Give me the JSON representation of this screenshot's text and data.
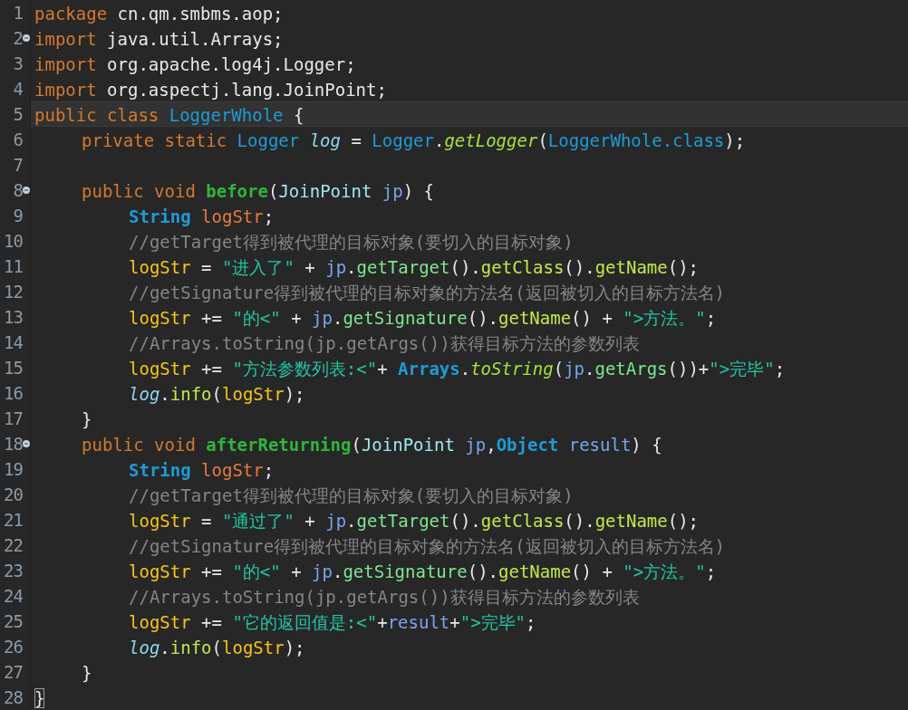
{
  "editor": {
    "lines": [
      {
        "number": "1",
        "fold": false,
        "current": false,
        "tokens": [
          {
            "kind": "kw",
            "t": "package"
          },
          {
            "kind": "plain",
            "t": " cn.qm.smbms.aop;"
          }
        ]
      },
      {
        "number": "2",
        "fold": true,
        "current": false,
        "tokens": [
          {
            "kind": "kw",
            "t": "import"
          },
          {
            "kind": "plain",
            "t": " java.util.Arrays;"
          }
        ]
      },
      {
        "number": "3",
        "fold": false,
        "current": false,
        "tokens": [
          {
            "kind": "kw",
            "t": "import"
          },
          {
            "kind": "plain",
            "t": " org.apache.log4j.Logger;"
          }
        ]
      },
      {
        "number": "4",
        "fold": false,
        "current": false,
        "tokens": [
          {
            "kind": "kw",
            "t": "import"
          },
          {
            "kind": "plain",
            "t": " org.aspectj.lang.JoinPoint;"
          }
        ]
      },
      {
        "number": "5",
        "fold": false,
        "current": true,
        "tokens": [
          {
            "kind": "kw",
            "t": "public class"
          },
          {
            "kind": "type",
            "t": " LoggerWhole"
          },
          {
            "kind": "plain",
            "t": " {"
          }
        ]
      },
      {
        "number": "6",
        "fold": false,
        "current": false,
        "tokens": [
          {
            "kind": "kw",
            "t": "\tprivate static"
          },
          {
            "kind": "type",
            "t": " Logger"
          },
          {
            "kind": "static",
            "t": " log"
          },
          {
            "kind": "plain",
            "t": " ="
          },
          {
            "kind": "type",
            "t": " Logger"
          },
          {
            "kind": "plain",
            "t": "."
          },
          {
            "kind": "smethod",
            "t": "getLogger"
          },
          {
            "kind": "plain",
            "t": "("
          },
          {
            "kind": "type",
            "t": "LoggerWhole.class"
          },
          {
            "kind": "plain",
            "t": ");"
          }
        ]
      },
      {
        "number": "7",
        "fold": false,
        "current": false
      },
      {
        "number": "8",
        "fold": true,
        "current": false,
        "tokens": [
          {
            "kind": "kw",
            "t": "\tpublic void"
          },
          {
            "kind": "decl",
            "t": " before"
          },
          {
            "kind": "plain",
            "t": "("
          },
          {
            "kind": "ptype",
            "t": "JoinPoint"
          },
          {
            "kind": "param",
            "t": " jp"
          },
          {
            "kind": "plain",
            "t": ") {"
          }
        ]
      },
      {
        "number": "9",
        "fold": false,
        "current": false,
        "tokens": [
          {
            "kind": "btype",
            "t": "\t\tString"
          },
          {
            "kind": "field",
            "t": " logStr"
          },
          {
            "kind": "plain",
            "t": ";"
          }
        ]
      },
      {
        "number": "10",
        "fold": false,
        "current": false,
        "tokens": [
          {
            "kind": "comment",
            "t": "\t\t//getTarget得到被代理的目标对象(要切入的目标对象)"
          }
        ]
      },
      {
        "number": "11",
        "fold": false,
        "current": false,
        "tokens": [
          {
            "kind": "var",
            "t": "\t\tlogStr"
          },
          {
            "kind": "plain",
            "t": " ="
          },
          {
            "kind": "str",
            "t": " \"进入了\""
          },
          {
            "kind": "plain",
            "t": " +"
          },
          {
            "kind": "param",
            "t": " jp"
          },
          {
            "kind": "plain",
            "t": "."
          },
          {
            "kind": "method",
            "t": "getTarget"
          },
          {
            "kind": "plain",
            "t": "()."
          },
          {
            "kind": "method2",
            "t": "getClass"
          },
          {
            "kind": "plain",
            "t": "()."
          },
          {
            "kind": "method2",
            "t": "getName"
          },
          {
            "kind": "plain",
            "t": "();"
          }
        ]
      },
      {
        "number": "12",
        "fold": false,
        "current": false,
        "tokens": [
          {
            "kind": "comment",
            "t": "\t\t//getSignature得到被代理的目标对象的方法名(返回被切入的目标方法名)"
          }
        ]
      },
      {
        "number": "13",
        "fold": false,
        "current": false,
        "tokens": [
          {
            "kind": "var",
            "t": "\t\tlogStr"
          },
          {
            "kind": "plain",
            "t": " +="
          },
          {
            "kind": "str",
            "t": " \"的<\""
          },
          {
            "kind": "plain",
            "t": " +"
          },
          {
            "kind": "param",
            "t": " jp"
          },
          {
            "kind": "plain",
            "t": "."
          },
          {
            "kind": "method",
            "t": "getSignature"
          },
          {
            "kind": "plain",
            "t": "()."
          },
          {
            "kind": "method2",
            "t": "getName"
          },
          {
            "kind": "plain",
            "t": "() +"
          },
          {
            "kind": "str",
            "t": " \">方法。\""
          },
          {
            "kind": "plain",
            "t": ";"
          }
        ]
      },
      {
        "number": "14",
        "fold": false,
        "current": false,
        "tokens": [
          {
            "kind": "comment",
            "t": "\t\t//Arrays.toString(jp.getArgs())获得目标方法的参数列表"
          }
        ]
      },
      {
        "number": "15",
        "fold": false,
        "current": false,
        "tokens": [
          {
            "kind": "var",
            "t": "\t\tlogStr"
          },
          {
            "kind": "plain",
            "t": " +="
          },
          {
            "kind": "str",
            "t": " \"方法参数列表:<\""
          },
          {
            "kind": "plain",
            "t": "+"
          },
          {
            "kind": "btype",
            "t": " Arrays"
          },
          {
            "kind": "plain",
            "t": "."
          },
          {
            "kind": "smethod",
            "t": "toString"
          },
          {
            "kind": "plain",
            "t": "("
          },
          {
            "kind": "param",
            "t": "jp"
          },
          {
            "kind": "plain",
            "t": "."
          },
          {
            "kind": "method",
            "t": "getArgs"
          },
          {
            "kind": "plain",
            "t": "())+"
          },
          {
            "kind": "str",
            "t": "\">完毕\""
          },
          {
            "kind": "plain",
            "t": ";"
          }
        ]
      },
      {
        "number": "16",
        "fold": false,
        "current": false,
        "tokens": [
          {
            "kind": "static",
            "t": "\t\tlog"
          },
          {
            "kind": "plain",
            "t": "."
          },
          {
            "kind": "method2",
            "t": "info"
          },
          {
            "kind": "plain",
            "t": "("
          },
          {
            "kind": "var",
            "t": "logStr"
          },
          {
            "kind": "plain",
            "t": ");"
          }
        ]
      },
      {
        "number": "17",
        "fold": false,
        "current": false,
        "tokens": [
          {
            "kind": "plain",
            "t": "\t}"
          }
        ]
      },
      {
        "number": "18",
        "fold": true,
        "current": false,
        "tokens": [
          {
            "kind": "kw",
            "t": "\tpublic void"
          },
          {
            "kind": "decl",
            "t": " afterReturning"
          },
          {
            "kind": "plain",
            "t": "("
          },
          {
            "kind": "ptype",
            "t": "JoinPoint"
          },
          {
            "kind": "param",
            "t": " jp"
          },
          {
            "kind": "plain",
            "t": ","
          },
          {
            "kind": "btype",
            "t": "Object"
          },
          {
            "kind": "param",
            "t": " result"
          },
          {
            "kind": "plain",
            "t": ") {"
          }
        ]
      },
      {
        "number": "19",
        "fold": false,
        "current": false,
        "tokens": [
          {
            "kind": "btype",
            "t": "\t\tString"
          },
          {
            "kind": "field",
            "t": " logStr"
          },
          {
            "kind": "plain",
            "t": ";"
          }
        ]
      },
      {
        "number": "20",
        "fold": false,
        "current": false,
        "tokens": [
          {
            "kind": "comment",
            "t": "\t\t//getTarget得到被代理的目标对象(要切入的目标对象)"
          }
        ]
      },
      {
        "number": "21",
        "fold": false,
        "current": false,
        "tokens": [
          {
            "kind": "var",
            "t": "\t\tlogStr"
          },
          {
            "kind": "plain",
            "t": " ="
          },
          {
            "kind": "str",
            "t": " \"通过了\""
          },
          {
            "kind": "plain",
            "t": " +"
          },
          {
            "kind": "param",
            "t": " jp"
          },
          {
            "kind": "plain",
            "t": "."
          },
          {
            "kind": "method",
            "t": "getTarget"
          },
          {
            "kind": "plain",
            "t": "()."
          },
          {
            "kind": "method2",
            "t": "getClass"
          },
          {
            "kind": "plain",
            "t": "()."
          },
          {
            "kind": "method2",
            "t": "getName"
          },
          {
            "kind": "plain",
            "t": "();"
          }
        ]
      },
      {
        "number": "22",
        "fold": false,
        "current": false,
        "tokens": [
          {
            "kind": "comment",
            "t": "\t\t//getSignature得到被代理的目标对象的方法名(返回被切入的目标方法名)"
          }
        ]
      },
      {
        "number": "23",
        "fold": false,
        "current": false,
        "tokens": [
          {
            "kind": "var",
            "t": "\t\tlogStr"
          },
          {
            "kind": "plain",
            "t": " +="
          },
          {
            "kind": "str",
            "t": " \"的<\""
          },
          {
            "kind": "plain",
            "t": " +"
          },
          {
            "kind": "param",
            "t": " jp"
          },
          {
            "kind": "plain",
            "t": "."
          },
          {
            "kind": "method",
            "t": "getSignature"
          },
          {
            "kind": "plain",
            "t": "()."
          },
          {
            "kind": "method2",
            "t": "getName"
          },
          {
            "kind": "plain",
            "t": "() +"
          },
          {
            "kind": "str",
            "t": " \">方法。\""
          },
          {
            "kind": "plain",
            "t": ";"
          }
        ]
      },
      {
        "number": "24",
        "fold": false,
        "current": false,
        "tokens": [
          {
            "kind": "comment",
            "t": "\t\t//Arrays.toString(jp.getArgs())获得目标方法的参数列表"
          }
        ]
      },
      {
        "number": "25",
        "fold": false,
        "current": false,
        "tokens": [
          {
            "kind": "var",
            "t": "\t\tlogStr"
          },
          {
            "kind": "plain",
            "t": " +="
          },
          {
            "kind": "str",
            "t": " \"它的返回值是:<\""
          },
          {
            "kind": "plain",
            "t": "+"
          },
          {
            "kind": "param",
            "t": "result"
          },
          {
            "kind": "plain",
            "t": "+"
          },
          {
            "kind": "str",
            "t": "\">完毕\""
          },
          {
            "kind": "plain",
            "t": ";"
          }
        ]
      },
      {
        "number": "26",
        "fold": false,
        "current": false,
        "tokens": [
          {
            "kind": "static",
            "t": "\t\tlog"
          },
          {
            "kind": "plain",
            "t": "."
          },
          {
            "kind": "method2",
            "t": "info"
          },
          {
            "kind": "plain",
            "t": "("
          },
          {
            "kind": "var",
            "t": "logStr"
          },
          {
            "kind": "plain",
            "t": ");"
          }
        ]
      },
      {
        "number": "27",
        "fold": false,
        "current": false,
        "tokens": [
          {
            "kind": "plain",
            "t": "\t}"
          }
        ]
      },
      {
        "number": "28",
        "fold": false,
        "current": false,
        "tokens": [
          {
            "kind": "match",
            "t": "}"
          }
        ]
      }
    ]
  }
}
